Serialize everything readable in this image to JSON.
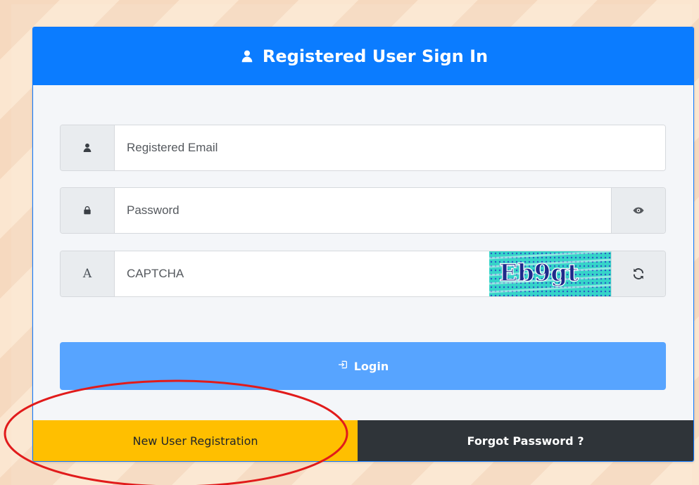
{
  "header": {
    "title": "Registered User Sign In",
    "icon": "user-icon"
  },
  "form": {
    "email": {
      "placeholder": "Registered Email",
      "value": "",
      "icon": "user-icon"
    },
    "password": {
      "placeholder": "Password",
      "value": "",
      "icon": "lock-icon",
      "toggle_icon": "eye-icon"
    },
    "captcha": {
      "placeholder": "CAPTCHA",
      "value": "",
      "icon_text": "A",
      "image_text": "Eb9gt",
      "refresh_icon": "refresh-icon"
    }
  },
  "buttons": {
    "login_label": "Login",
    "login_icon": "sign-in-icon",
    "new_user_label": "New User Registration",
    "forgot_password_label": "Forgot Password ?"
  },
  "annotation": {
    "shape": "ellipse",
    "color": "#e11b1b",
    "target": "new-user-registration-button"
  },
  "colors": {
    "header": "#0b7cff",
    "login": "#57a4ff",
    "register": "#ffbf00",
    "forgot": "#2f3439",
    "background": "#fbe6d0"
  }
}
